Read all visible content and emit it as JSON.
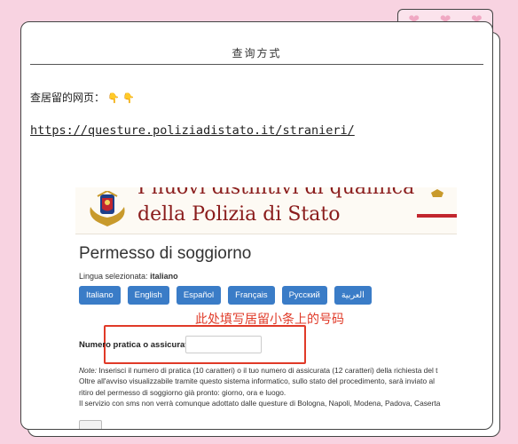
{
  "title": "查询方式",
  "note": "查居留的网页：",
  "note_emoji": "👇 👇",
  "link": "https://questure.poliziadistato.it/stranieri/",
  "site": {
    "banner_top": "I nuovi distintivi di qualifica",
    "banner_main": "della Polizia di Stato",
    "page_title": "Permesso di soggiorno",
    "lang_prefix": "Lingua selezionata:",
    "lang_selected": "italiano",
    "languages": [
      "Italiano",
      "English",
      "Español",
      "Français",
      "Русский",
      "العربية"
    ],
    "annotation": "此处填写居留小条上的号码",
    "field_label": "Numero pratica o assicurata",
    "note_label": "Note:",
    "note_line1": "Inserisci il numero di pratica (10 caratteri) o il tuo numero di assicurata (12 caratteri) della richiesta del t",
    "note_line2": "Oltre all'avviso visualizzabile tramite questo sistema informatico, sullo stato del procedimento, sarà inviato al",
    "note_line3": "ritiro del permesso di soggiorno già pronto: giorno, ora e luogo.",
    "note_line4": "Il servizio con sms non verrà comunque adottato dalle questure di Bologna, Napoli, Modena, Padova, Caserta"
  }
}
